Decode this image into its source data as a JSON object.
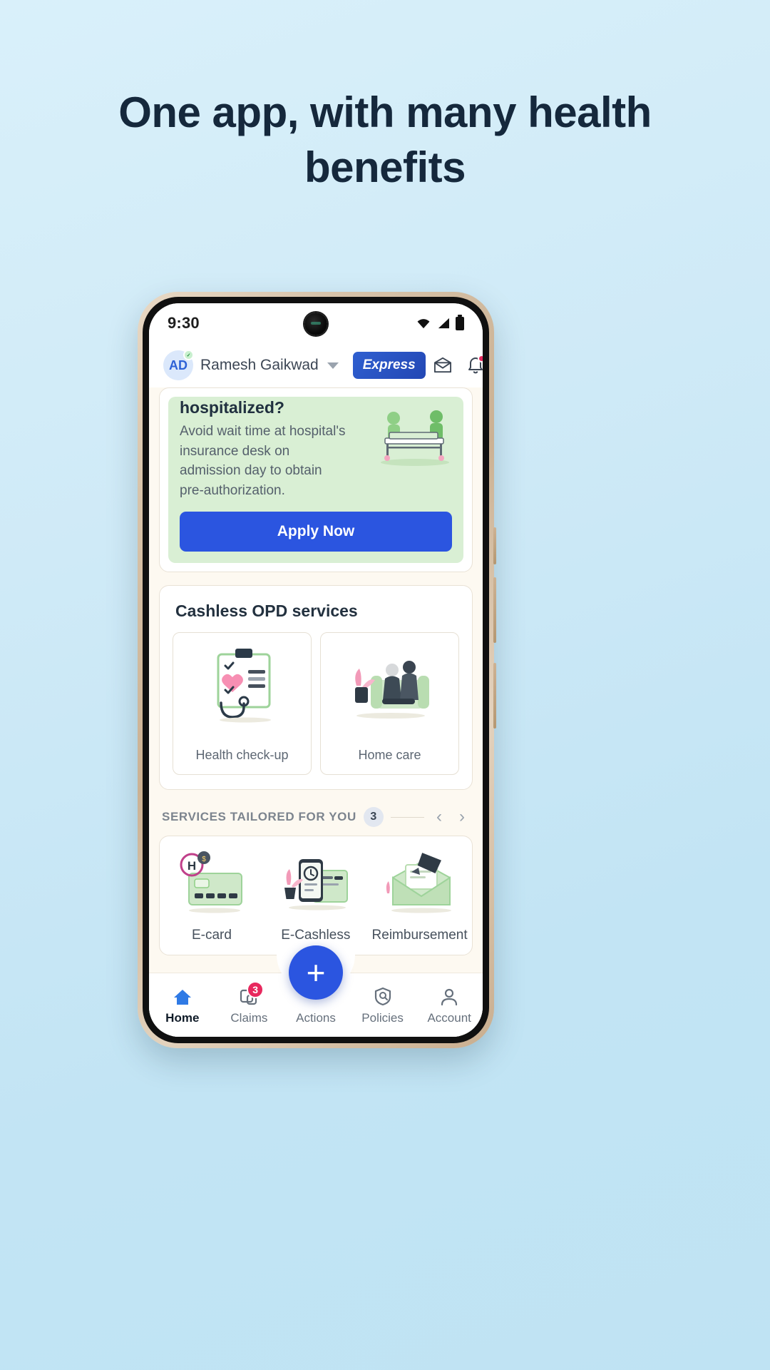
{
  "headline": "One app, with many health benefits",
  "colors": {
    "page_bg": "#cfeaf7",
    "headline": "#15283c",
    "accent_blue": "#2b55e0",
    "promo_green": "#d9efd4",
    "badge_red": "#e8285e"
  },
  "phone": {
    "status_bar": {
      "time": "9:30",
      "icons": [
        "wifi-icon",
        "signal-icon",
        "battery-icon"
      ]
    },
    "header": {
      "avatar_initials": "AD",
      "avatar_badge": "verified-badge",
      "user_name": "Ramesh Gaikwad",
      "chevron": "chevron-down-icon",
      "express_label": "Express",
      "wallet_icon": "wallet-icon",
      "bell_icon": "bell-icon",
      "bell_has_alert": true
    },
    "promo_card": {
      "title": "hospitalized?",
      "body": "Avoid wait time at hospital's insurance desk on admission day to obtain pre-authorization.",
      "cta_label": "Apply Now",
      "illustration": "hospital-bed-illustration"
    },
    "opd_card": {
      "title": "Cashless OPD services",
      "tiles": [
        {
          "label": "Health check-up",
          "icon": "clipboard-stethoscope-icon"
        },
        {
          "label": "Home care",
          "icon": "home-care-couple-icon"
        }
      ]
    },
    "services_section": {
      "title": "SERVICES TAILORED FOR YOU",
      "count": "3",
      "prev_arrow": "chevron-left-icon",
      "next_arrow": "chevron-right-icon",
      "items": [
        {
          "label": "E-card",
          "icon": "e-card-illustration"
        },
        {
          "label": "E-Cashless",
          "icon": "e-cashless-illustration"
        },
        {
          "label": "Reimbursement",
          "icon": "reimbursement-illustration"
        }
      ]
    },
    "fab": {
      "label": "+",
      "name": "add-action-button"
    },
    "bottom_nav": [
      {
        "label": "Home",
        "icon": "home-icon",
        "active": true,
        "badge": ""
      },
      {
        "label": "Claims",
        "icon": "claims-icon",
        "active": false,
        "badge": "3"
      },
      {
        "label": "Actions",
        "icon": "actions-icon",
        "active": false,
        "badge": ""
      },
      {
        "label": "Policies",
        "icon": "policies-shield-icon",
        "active": false,
        "badge": ""
      },
      {
        "label": "Account",
        "icon": "account-person-icon",
        "active": false,
        "badge": ""
      }
    ]
  }
}
